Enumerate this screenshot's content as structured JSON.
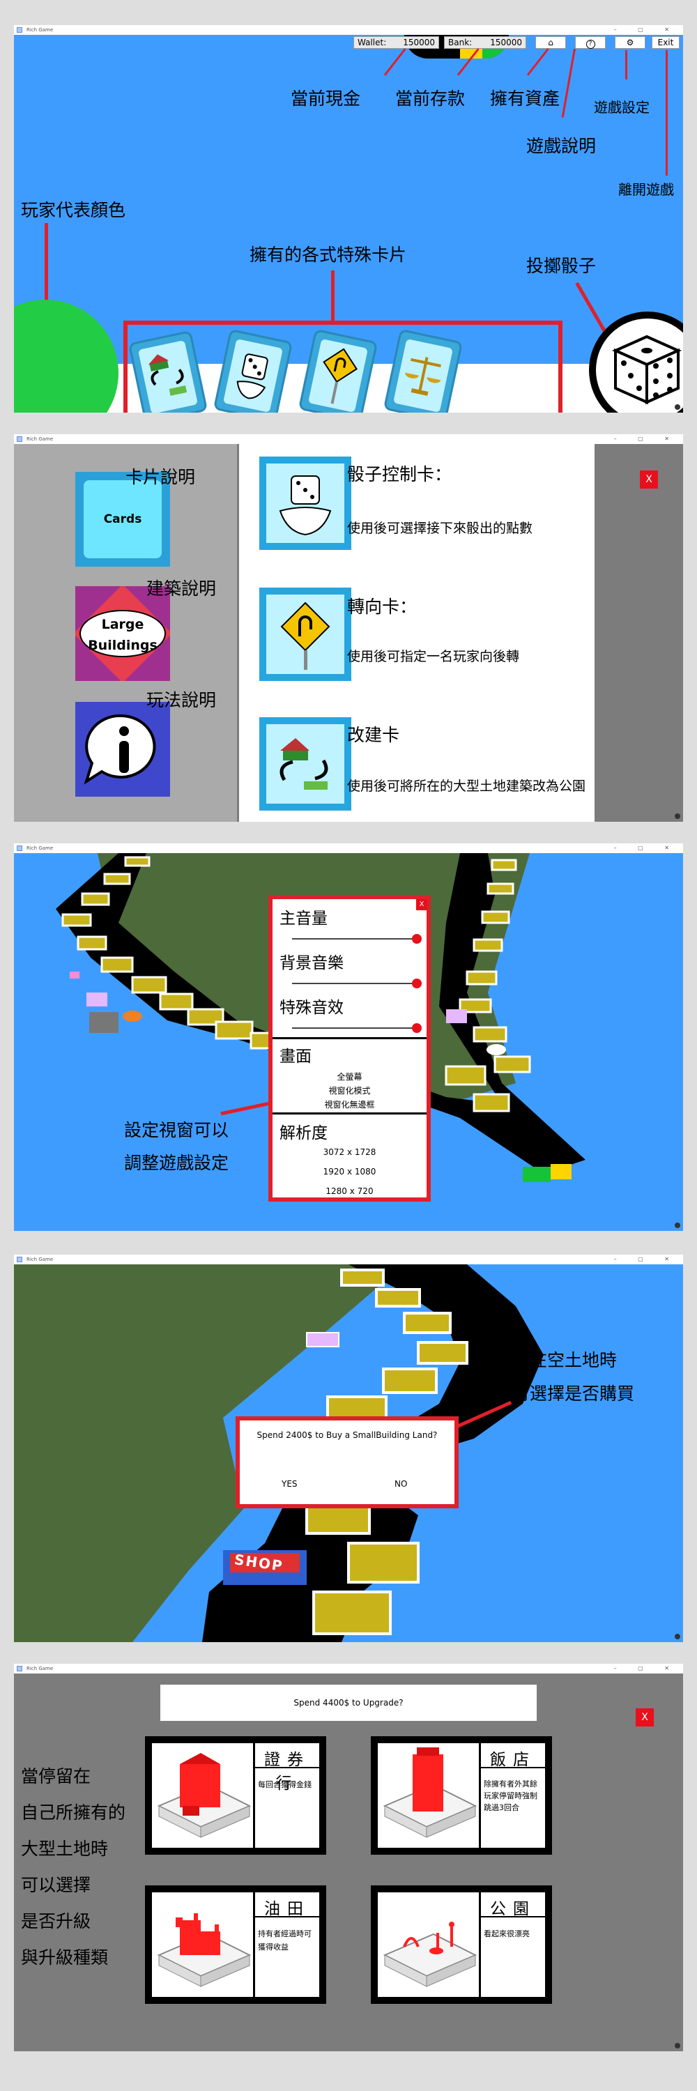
{
  "window_title": "Rich Game",
  "window_controls": "–  ▢  ✕",
  "panel1": {
    "wallet_label": "Wallet:",
    "wallet_value": "150000",
    "bank_label": "Bank:",
    "bank_value": "150000",
    "buttons": {
      "home_icon": "⌂",
      "help_icon": "?",
      "settings_icon": "⚙",
      "exit_label": "Exit"
    },
    "annotations": {
      "cash": "當前現金",
      "deposit": "當前存款",
      "assets": "擁有資產",
      "settings": "遊戲設定",
      "help": "遊戲說明",
      "exit": "離開遊戲",
      "player_color": "玩家代表顏色",
      "cards": "擁有的各式特殊卡片",
      "dice": "投擲骰子"
    },
    "card_icons": [
      "rebuild-icon",
      "dice-icon",
      "u-turn-sign-icon",
      "scales-icon"
    ],
    "player_color": "#22cc44",
    "sky_color": "#3f9cff"
  },
  "panel2": {
    "menu": [
      {
        "button_text": "Cards",
        "label": "卡片說明"
      },
      {
        "button_text_1": "Large",
        "button_text_2": "Buildings",
        "label": "建築說明"
      },
      {
        "icon": "info-icon",
        "label": "玩法說明"
      }
    ],
    "items": [
      {
        "title": "骰子控制卡：",
        "desc": "使用後可選擇接下來骰出的點數",
        "icon": "dice-control-icon"
      },
      {
        "title": "轉向卡：",
        "desc": "使用後可指定一名玩家向後轉",
        "icon": "u-turn-sign-icon"
      },
      {
        "title": "改建卡",
        "desc": "使用後可將所在的大型土地建築改為公園",
        "icon": "rebuild-icon"
      }
    ],
    "close_label": "X"
  },
  "panel3": {
    "close_label": "X",
    "volume_labels": [
      "主音量",
      "背景音樂",
      "特殊音效"
    ],
    "display_label": "畫面",
    "display_options": [
      "全螢幕",
      "視窗化模式",
      "視窗化無邊框"
    ],
    "resolution_label": "解析度",
    "resolution_options": [
      "3072 x 1728",
      "1920 x 1080",
      "1280 x 720"
    ],
    "annotation_line1": "設定視窗可以",
    "annotation_line2": "調整遊戲設定"
  },
  "panel4": {
    "dialog_text": "Spend 2400$ to Buy a SmallBuilding Land?",
    "yes_label": "YES",
    "no_label": "NO",
    "annotation_line1": "停在空土地時",
    "annotation_line2": "可選擇是否購買",
    "shop_sign": "SHOP"
  },
  "panel5": {
    "prompt": "Spend 4400$ to Upgrade?",
    "close_label": "X",
    "annotation_lines": [
      "當停留在",
      "自己所擁有的",
      "大型土地時",
      "可以選擇",
      "是否升級",
      "與升級種類"
    ],
    "buildings": [
      {
        "name": "證券行",
        "desc": "每回合獲得金錢"
      },
      {
        "name": "飯店",
        "desc": "除擁有者外其餘玩家停留時強制跳過3回合"
      },
      {
        "name": "油田",
        "desc": "持有者經過時可獲得收益"
      },
      {
        "name": "公園",
        "desc": "看起來很漂亮"
      }
    ]
  }
}
